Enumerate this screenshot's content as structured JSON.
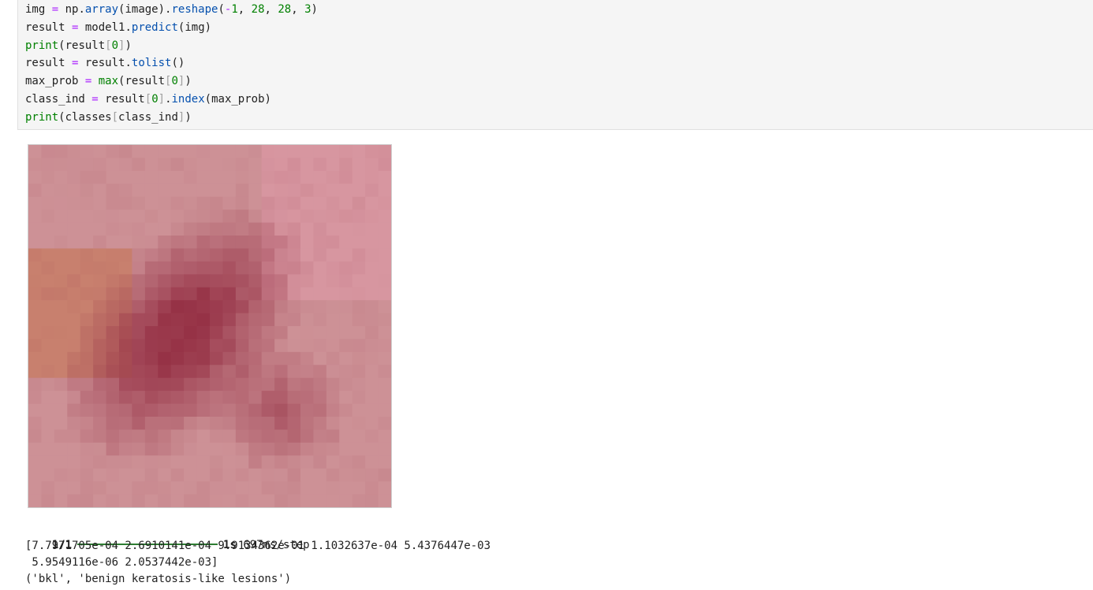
{
  "code": {
    "lines": [
      [
        [
          "d",
          "img "
        ],
        [
          "o",
          "="
        ],
        [
          "d",
          " np."
        ],
        [
          "f",
          "array"
        ],
        [
          "d",
          "(image)."
        ],
        [
          "f",
          "reshape"
        ],
        [
          "d",
          "("
        ],
        [
          "o",
          "-"
        ],
        [
          "n",
          "1"
        ],
        [
          "d",
          ", "
        ],
        [
          "n",
          "28"
        ],
        [
          "d",
          ", "
        ],
        [
          "n",
          "28"
        ],
        [
          "d",
          ", "
        ],
        [
          "n",
          "3"
        ],
        [
          "d",
          ")"
        ]
      ],
      [
        [
          "d",
          "result "
        ],
        [
          "o",
          "="
        ],
        [
          "d",
          " model1."
        ],
        [
          "f",
          "predict"
        ],
        [
          "d",
          "(img)"
        ]
      ],
      [
        [
          "k",
          "print"
        ],
        [
          "d",
          "(result"
        ],
        [
          "p",
          "["
        ],
        [
          "n",
          "0"
        ],
        [
          "p",
          "]"
        ],
        [
          "d",
          ")"
        ]
      ],
      [
        [
          "d",
          "result "
        ],
        [
          "o",
          "="
        ],
        [
          "d",
          " result."
        ],
        [
          "f",
          "tolist"
        ],
        [
          "d",
          "()"
        ]
      ],
      [
        [
          "d",
          "max_prob "
        ],
        [
          "o",
          "="
        ],
        [
          "d",
          " "
        ],
        [
          "k",
          "max"
        ],
        [
          "d",
          "(result"
        ],
        [
          "p",
          "["
        ],
        [
          "n",
          "0"
        ],
        [
          "p",
          "]"
        ],
        [
          "d",
          ")"
        ]
      ],
      [
        [
          "d",
          "class_ind "
        ],
        [
          "o",
          "="
        ],
        [
          "d",
          " result"
        ],
        [
          "p",
          "["
        ],
        [
          "n",
          "0"
        ],
        [
          "p",
          "]"
        ],
        [
          "d",
          "."
        ],
        [
          "f",
          "index"
        ],
        [
          "d",
          "(max_prob)"
        ]
      ],
      [
        [
          "k",
          "print"
        ],
        [
          "d",
          "(classes"
        ],
        [
          "p",
          "["
        ],
        [
          "d",
          "class_ind"
        ],
        [
          "p",
          "]"
        ],
        [
          "d",
          ")"
        ]
      ]
    ]
  },
  "output": {
    "image_description": "pixelated-lesion-image",
    "progress": {
      "count": "1/1",
      "fraction": 1.0,
      "time": "1s",
      "step": "697ms/step"
    },
    "prediction_line_1": "[7.7971705e-04 2.6910141e-04 9.9134362e-01 1.1032637e-04 5.4376447e-03",
    "prediction_line_2": " 5.9549116e-06 2.0537442e-03]",
    "class_result": "('bkl', 'benign keratosis-like lesions')"
  },
  "colors": {
    "code_background": "#f5f5f5",
    "keyword": "#008000",
    "operator": "#aa22ff",
    "function": "#0550ae",
    "progress": "#2e7d32"
  }
}
